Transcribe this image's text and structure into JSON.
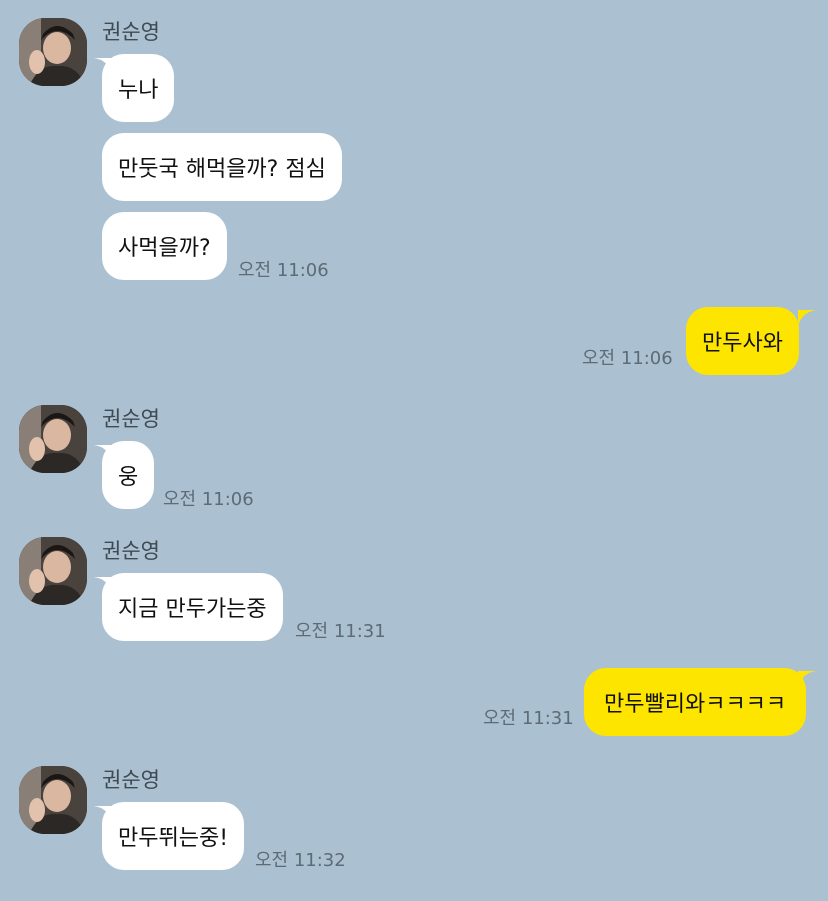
{
  "colors": {
    "background": "#abc1d1",
    "incoming_bubble": "#ffffff",
    "outgoing_bubble": "#fee500"
  },
  "messages": [
    {
      "sender": "권순영",
      "text": "누나"
    },
    {
      "text": "만둣국 해먹을까? 점심"
    },
    {
      "text": "사먹을까?",
      "time": "오전 11:06"
    },
    {
      "text": "만두사와",
      "time": "오전 11:06"
    },
    {
      "sender": "권순영",
      "text": "웅",
      "time": "오전 11:06"
    },
    {
      "sender": "권순영",
      "text": "지금 만두가는중",
      "time": "오전 11:31"
    },
    {
      "text": "만두빨리와ㅋㅋㅋㅋ",
      "time": "오전 11:31"
    },
    {
      "sender": "권순영",
      "text": "만두뛰는중!",
      "time": "오전 11:32"
    }
  ]
}
